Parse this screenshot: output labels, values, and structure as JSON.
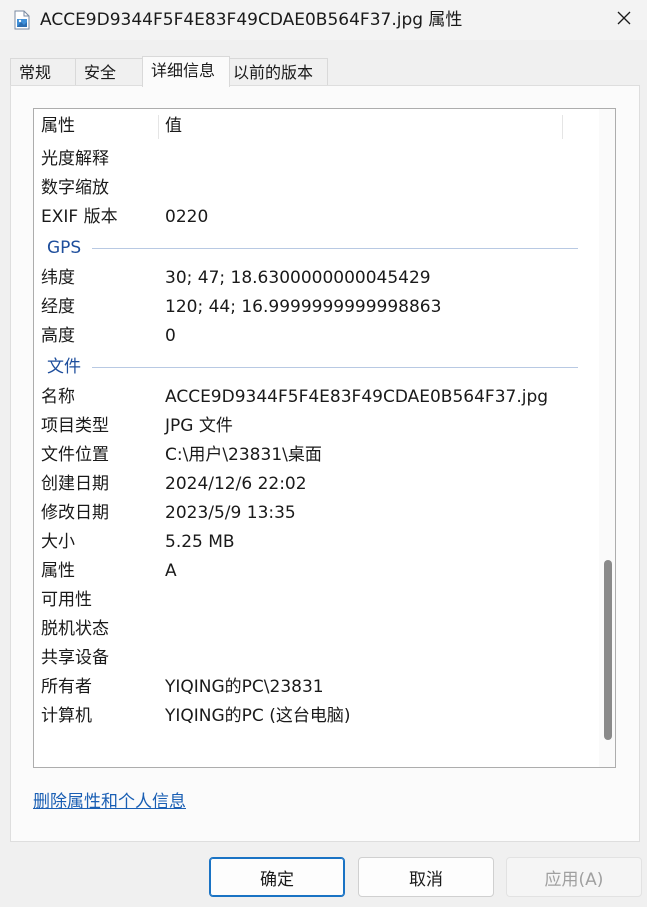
{
  "window": {
    "title": "ACCE9D9344F5F4E83F49CDAE0B564F37.jpg 属性",
    "icon": "image-file-icon",
    "close_icon": "close-icon"
  },
  "tabs": [
    {
      "label": "常规"
    },
    {
      "label": "安全"
    },
    {
      "label": "详细信息",
      "active": true
    },
    {
      "label": "以前的版本"
    }
  ],
  "table": {
    "headers": {
      "name": "属性",
      "value": "值"
    },
    "rows_top": [
      {
        "name": "光度解释",
        "value": ""
      },
      {
        "name": "数字缩放",
        "value": ""
      },
      {
        "name": "EXIF 版本",
        "value": "0220"
      }
    ],
    "gps_group": "GPS",
    "rows_gps": [
      {
        "name": "纬度",
        "value": "30; 47; 18.6300000000045429"
      },
      {
        "name": "经度",
        "value": "120; 44; 16.9999999999998863"
      },
      {
        "name": "高度",
        "value": "0"
      }
    ],
    "file_group": "文件",
    "rows_file": [
      {
        "name": "名称",
        "value": "ACCE9D9344F5F4E83F49CDAE0B564F37.jpg"
      },
      {
        "name": "项目类型",
        "value": "JPG 文件"
      },
      {
        "name": "文件位置",
        "value": "C:\\用户\\23831\\桌面"
      },
      {
        "name": "创建日期",
        "value": "2024/12/6 22:02"
      },
      {
        "name": "修改日期",
        "value": "2023/5/9 13:35"
      },
      {
        "name": "大小",
        "value": "5.25 MB"
      },
      {
        "name": "属性",
        "value": "A"
      },
      {
        "name": "可用性",
        "value": ""
      },
      {
        "name": "脱机状态",
        "value": ""
      },
      {
        "name": "共享设备",
        "value": ""
      },
      {
        "name": "所有者",
        "value": "YIQING的PC\\23831"
      },
      {
        "name": "计算机",
        "value": "YIQING的PC (这台电脑)"
      }
    ]
  },
  "link": "删除属性和个人信息",
  "buttons": {
    "ok": "确定",
    "cancel": "取消",
    "apply": "应用(A)"
  },
  "colors": {
    "group_header": "#1e4e9c",
    "link": "#1a5fb4",
    "accent_border": "#1a73c4"
  }
}
